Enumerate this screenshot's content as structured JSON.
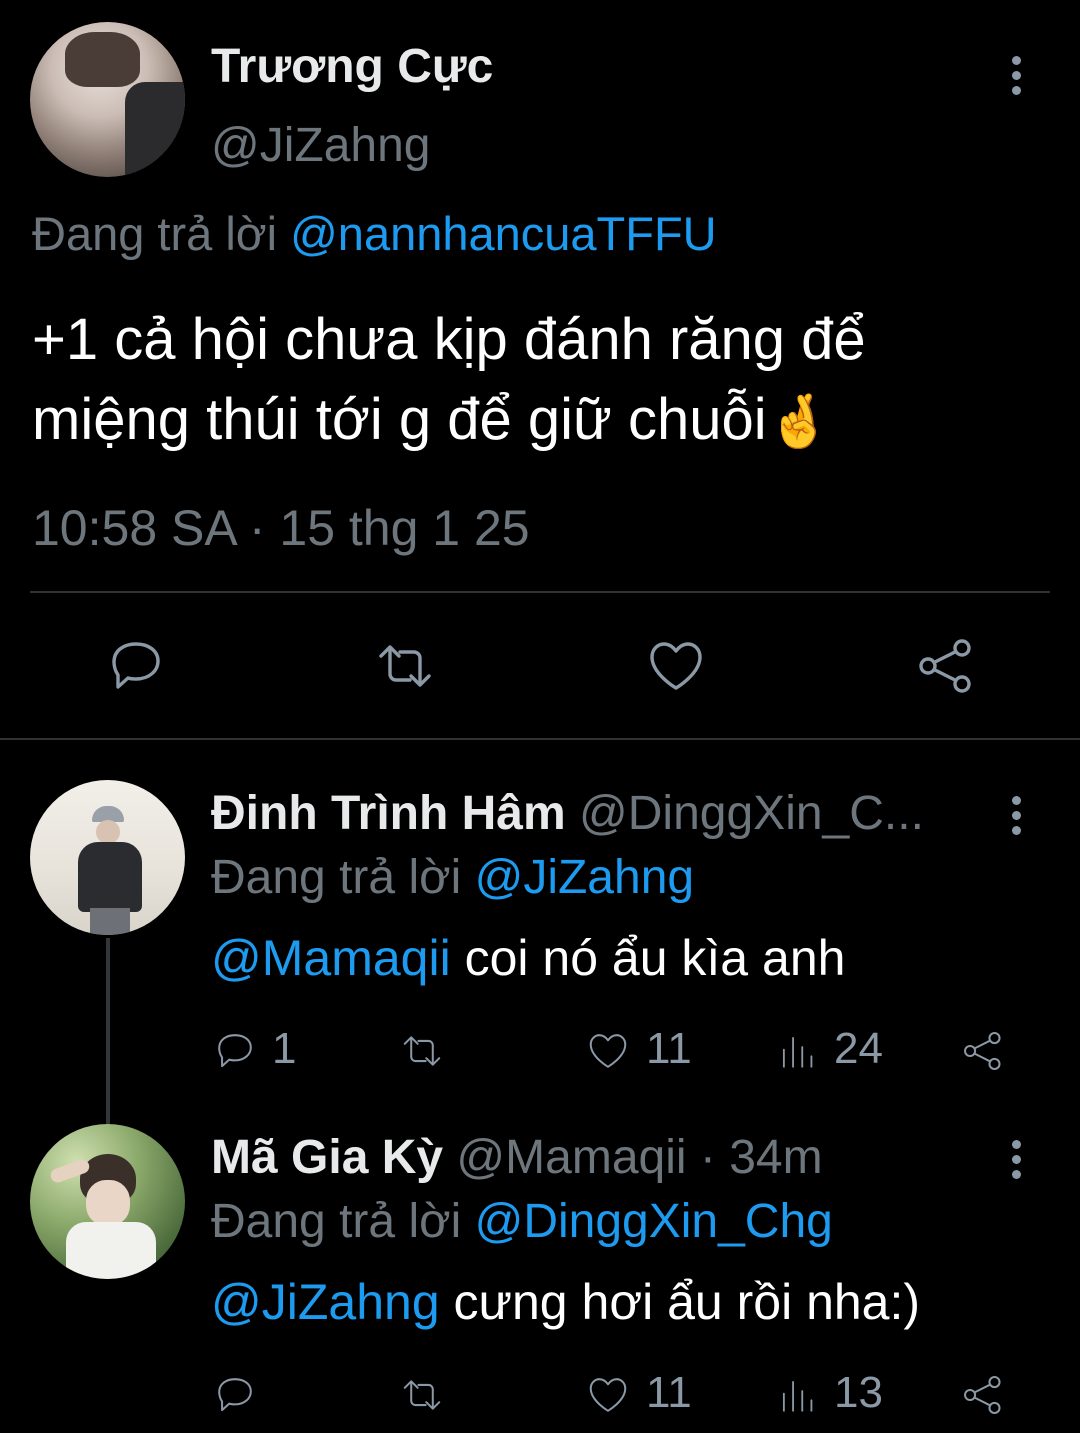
{
  "main_tweet": {
    "display_name": "Trương Cực",
    "handle": "@JiZahng",
    "replying_prefix": "Đang trả lời",
    "replying_to": "@nannhancuaTFFU",
    "text_line1": "+1 cả hội chưa kịp đánh răng để",
    "text_line2": "miệng thúi tới g để giữ chuỗi",
    "emoji": "🤞",
    "timestamp": "10:58 SA · 15 thg 1 25"
  },
  "replies": [
    {
      "display_name": "Đinh Trình Hâm",
      "handle": "@DinggXin_C...",
      "replying_prefix": "Đang trả lời",
      "replying_to": "@JiZahng",
      "mention": "@Mamaqii",
      "text": " coi nó ẩu kìa anh",
      "replies_count": "1",
      "retweets_count": "",
      "likes_count": "11",
      "views_count": "24"
    },
    {
      "display_name": "Mã Gia Kỳ",
      "handle": "@Mamaqii",
      "time": "· 34m",
      "replying_prefix": "Đang trả lời",
      "replying_to": "@DinggXin_Chg",
      "mention": "@JiZahng",
      "text": " cưng hơi ẩu rồi nha:)",
      "replies_count": "",
      "retweets_count": "",
      "likes_count": "11",
      "views_count": "13"
    }
  ],
  "colors": {
    "background": "#000000",
    "text": "#e7e9ea",
    "muted": "#6e767d",
    "link": "#1d9bf0",
    "icon": "#8b98a5"
  }
}
